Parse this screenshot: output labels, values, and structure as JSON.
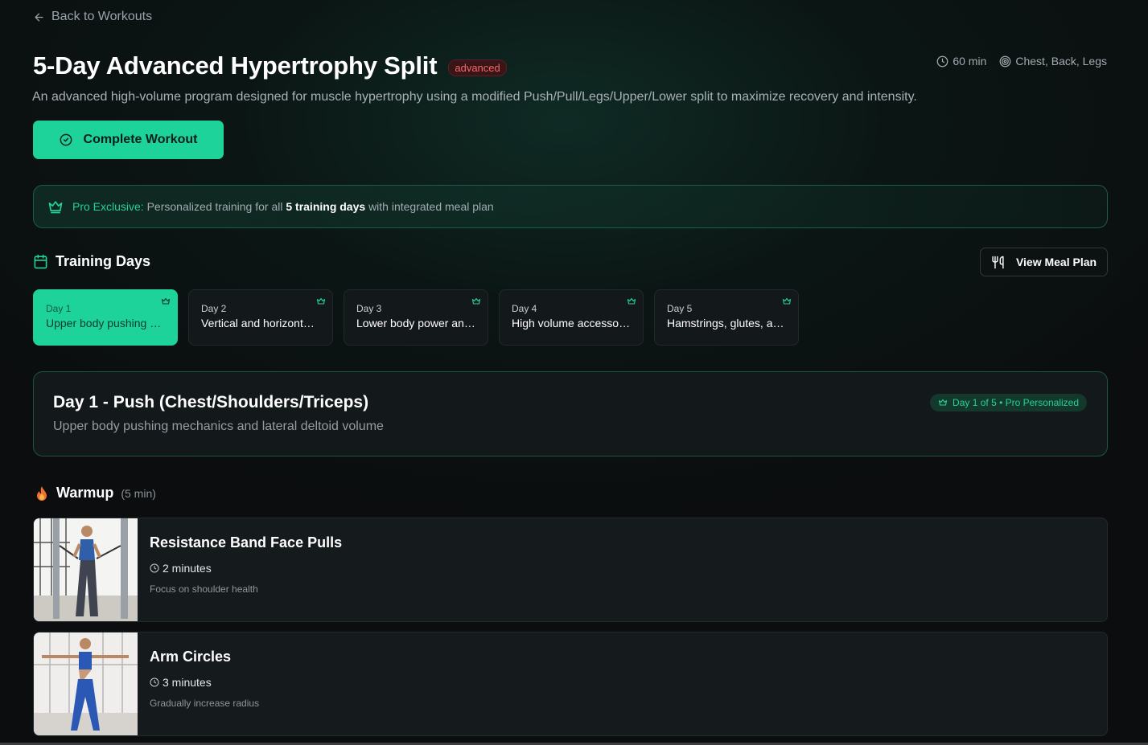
{
  "nav": {
    "back_label": "Back to Workouts"
  },
  "workout": {
    "title": "5-Day Advanced Hypertrophy Split",
    "level": "advanced",
    "duration": "60 min",
    "muscles": "Chest, Back, Legs",
    "description": "An advanced high-volume program designed for muscle hypertrophy using a modified Push/Pull/Legs/Upper/Lower split to maximize recovery and intensity.",
    "complete_label": "Complete Workout"
  },
  "pro_banner": {
    "label": "Pro Exclusive:",
    "text_before": "Personalized training for all",
    "highlight": "5 training days",
    "text_after": "with integrated meal plan"
  },
  "training_days": {
    "heading": "Training Days",
    "meal_plan_label": "View Meal Plan",
    "days": [
      {
        "label": "Day 1",
        "text": "Upper body pushing mechanics and lateral deltoid volume",
        "active": true
      },
      {
        "label": "Day 2",
        "text": "Vertical and horizontal pulling",
        "active": false
      },
      {
        "label": "Day 3",
        "text": "Lower body power and strength",
        "active": false
      },
      {
        "label": "Day 4",
        "text": "High volume accessory work",
        "active": false
      },
      {
        "label": "Day 5",
        "text": "Hamstrings, glutes, and posterior chain",
        "active": false
      }
    ]
  },
  "day_detail": {
    "title": "Day 1 - Push (Chest/Shoulders/Triceps)",
    "subtitle": "Upper body pushing mechanics and lateral deltoid volume",
    "pill": "Day 1 of 5 • Pro Personalized"
  },
  "warmup": {
    "title": "Warmup",
    "duration": "(5 min)",
    "exercises": [
      {
        "name": "Resistance Band Face Pulls",
        "duration": "2 minutes",
        "note": "Focus on shoulder health"
      },
      {
        "name": "Arm Circles",
        "duration": "3 minutes",
        "note": "Gradually increase radius"
      }
    ]
  },
  "colors": {
    "accent": "#1ed39a",
    "danger": "#f46a6a",
    "card": "#151a1c",
    "background": "#0b0d0e"
  },
  "icons": [
    "arrow-left-icon",
    "clock-icon",
    "target-icon",
    "check-circle-icon",
    "crown-icon",
    "calendar-icon",
    "utensils-icon",
    "flame-icon"
  ]
}
